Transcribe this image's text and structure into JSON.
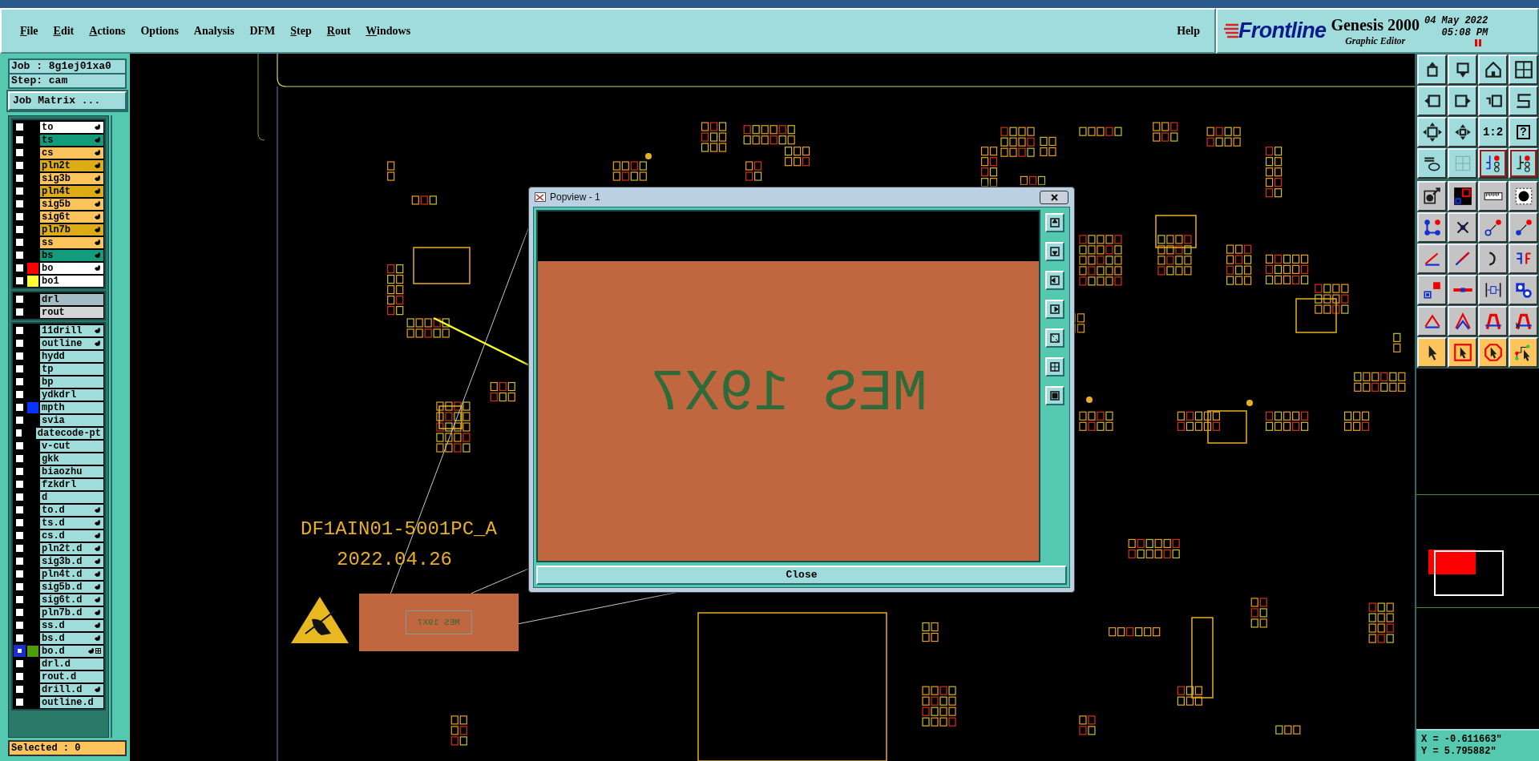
{
  "menu": [
    {
      "label": "File",
      "underlined": true
    },
    {
      "label": "Edit",
      "underlined": true
    },
    {
      "label": "Actions",
      "underlined": true
    },
    {
      "label": "Options",
      "underlined": false
    },
    {
      "label": "Analysis",
      "underlined": false
    },
    {
      "label": "DFM",
      "underlined": false
    },
    {
      "label": "Step",
      "underlined": true
    },
    {
      "label": "Rout",
      "underlined": true
    },
    {
      "label": "Windows",
      "underlined": true
    }
  ],
  "help": "Help",
  "brand": {
    "logo": "Frontline",
    "product": "Genesis 2000",
    "subtitle": "Graphic Editor",
    "date": "04 May 2022",
    "time": "05:08 PM"
  },
  "job": {
    "job": "Job : 8g1ej01xa0",
    "step": "Step: cam",
    "matrix_button": "Job Matrix ..."
  },
  "layer_groups": [
    {
      "layers": [
        {
          "name": "to",
          "color": "#ffffff",
          "affected": true,
          "selected": false
        },
        {
          "name": "ts",
          "color": "#139c7c",
          "affected": true,
          "selected": false
        },
        {
          "name": "cs",
          "color": "#fcc45c",
          "affected": true,
          "selected": false
        },
        {
          "name": "pln2t",
          "color": "#dcac14",
          "affected": true,
          "selected": false
        },
        {
          "name": "sig3b",
          "color": "#fcc45c",
          "affected": true,
          "selected": false
        },
        {
          "name": "pln4t",
          "color": "#dcac14",
          "affected": true,
          "selected": false
        },
        {
          "name": "sig5b",
          "color": "#fcc45c",
          "affected": true,
          "selected": false
        },
        {
          "name": "sig6t",
          "color": "#fcc45c",
          "affected": true,
          "selected": false
        },
        {
          "name": "pln7b",
          "color": "#dcac14",
          "affected": true,
          "selected": false
        },
        {
          "name": "ss",
          "color": "#fcc45c",
          "affected": true,
          "selected": false
        },
        {
          "name": "bs",
          "color": "#139c7c",
          "affected": true,
          "selected": false
        },
        {
          "name": "bo",
          "color": "#ffffff",
          "marker": {
            "color": "#ff0000"
          },
          "affected": true,
          "selected": false
        },
        {
          "name": "bo1",
          "color": "#ffffff",
          "marker": {
            "color": "#ffff33"
          },
          "affected": false,
          "selected": false
        }
      ]
    },
    {
      "layers": [
        {
          "name": "drl",
          "color": "#a4bcc4",
          "affected": false,
          "selected": false
        },
        {
          "name": "rout",
          "color": "#d4d4d4",
          "affected": false,
          "selected": false
        }
      ]
    },
    {
      "layers": [
        {
          "name": "11drill",
          "color": "#a0dcdc",
          "affected": true,
          "selected": false
        },
        {
          "name": "outline",
          "color": "#a0dcdc",
          "affected": true,
          "selected": false
        },
        {
          "name": "hydd",
          "color": "#a0dcdc",
          "affected": false,
          "selected": false
        },
        {
          "name": "tp",
          "color": "#a0dcdc",
          "affected": false,
          "selected": false
        },
        {
          "name": "bp",
          "color": "#a0dcdc",
          "affected": false,
          "selected": false
        },
        {
          "name": "ydkdrl",
          "color": "#a0dcdc",
          "affected": false,
          "selected": false
        },
        {
          "name": "mpth",
          "color": "#a0dcdc",
          "marker": {
            "color": "#0a32ff"
          },
          "affected": false,
          "selected": false
        },
        {
          "name": "svia",
          "color": "#a0dcdc",
          "affected": false,
          "selected": false
        },
        {
          "name": "datecode-pt",
          "color": "#a0dcdc",
          "affected": false,
          "selected": false
        },
        {
          "name": "v-cut",
          "color": "#a0dcdc",
          "affected": false,
          "selected": false
        },
        {
          "name": "gkk",
          "color": "#a0dcdc",
          "affected": false,
          "selected": false
        },
        {
          "name": "biaozhu",
          "color": "#a0dcdc",
          "affected": false,
          "selected": false
        },
        {
          "name": "fzkdrl",
          "color": "#a0dcdc",
          "affected": false,
          "selected": false
        },
        {
          "name": "d",
          "color": "#a0dcdc",
          "affected": false,
          "selected": false
        },
        {
          "name": "to.d",
          "color": "#a0dcdc",
          "affected": true,
          "selected": false
        },
        {
          "name": "ts.d",
          "color": "#a0dcdc",
          "affected": true,
          "selected": false
        },
        {
          "name": "cs.d",
          "color": "#a0dcdc",
          "affected": true,
          "selected": false
        },
        {
          "name": "pln2t.d",
          "color": "#a0dcdc",
          "affected": true,
          "selected": false
        },
        {
          "name": "sig3b.d",
          "color": "#a0dcdc",
          "affected": true,
          "selected": false
        },
        {
          "name": "pln4t.d",
          "color": "#a0dcdc",
          "affected": true,
          "selected": false
        },
        {
          "name": "sig5b.d",
          "color": "#a0dcdc",
          "affected": true,
          "selected": false
        },
        {
          "name": "sig6t.d",
          "color": "#a0dcdc",
          "affected": true,
          "selected": false
        },
        {
          "name": "pln7b.d",
          "color": "#a0dcdc",
          "affected": true,
          "selected": false
        },
        {
          "name": "ss.d",
          "color": "#a0dcdc",
          "affected": true,
          "selected": false
        },
        {
          "name": "bs.d",
          "color": "#a0dcdc",
          "affected": true,
          "selected": false
        },
        {
          "name": "bo.d",
          "color": "#a0dcdc",
          "marker": {
            "color": "#4c9c0c"
          },
          "affected": true,
          "plus_box": true,
          "selected": true
        },
        {
          "name": "drl.d",
          "color": "#a0dcdc",
          "affected": false,
          "selected": false
        },
        {
          "name": "rout.d",
          "color": "#a0dcdc",
          "affected": false,
          "selected": false
        },
        {
          "name": "drill.d",
          "color": "#a0dcdc",
          "affected": true,
          "selected": false
        },
        {
          "name": "outline.d",
          "color": "#a0dcdc",
          "affected": false,
          "selected": false
        }
      ]
    }
  ],
  "selected_count": "Selected : 0",
  "board": {
    "texts": [
      "DF1AIN01-5001PC_A",
      "2022.04.26"
    ],
    "marking": "MES 19X7"
  },
  "popup": {
    "title": "Popview - 1",
    "zoom_text": "MES 19X7",
    "close": "Close"
  },
  "toolbar_labels": [
    "1:2",
    "?"
  ],
  "coords": {
    "x": "X = -0.611663\"",
    "y": "Y = 5.795882\""
  }
}
